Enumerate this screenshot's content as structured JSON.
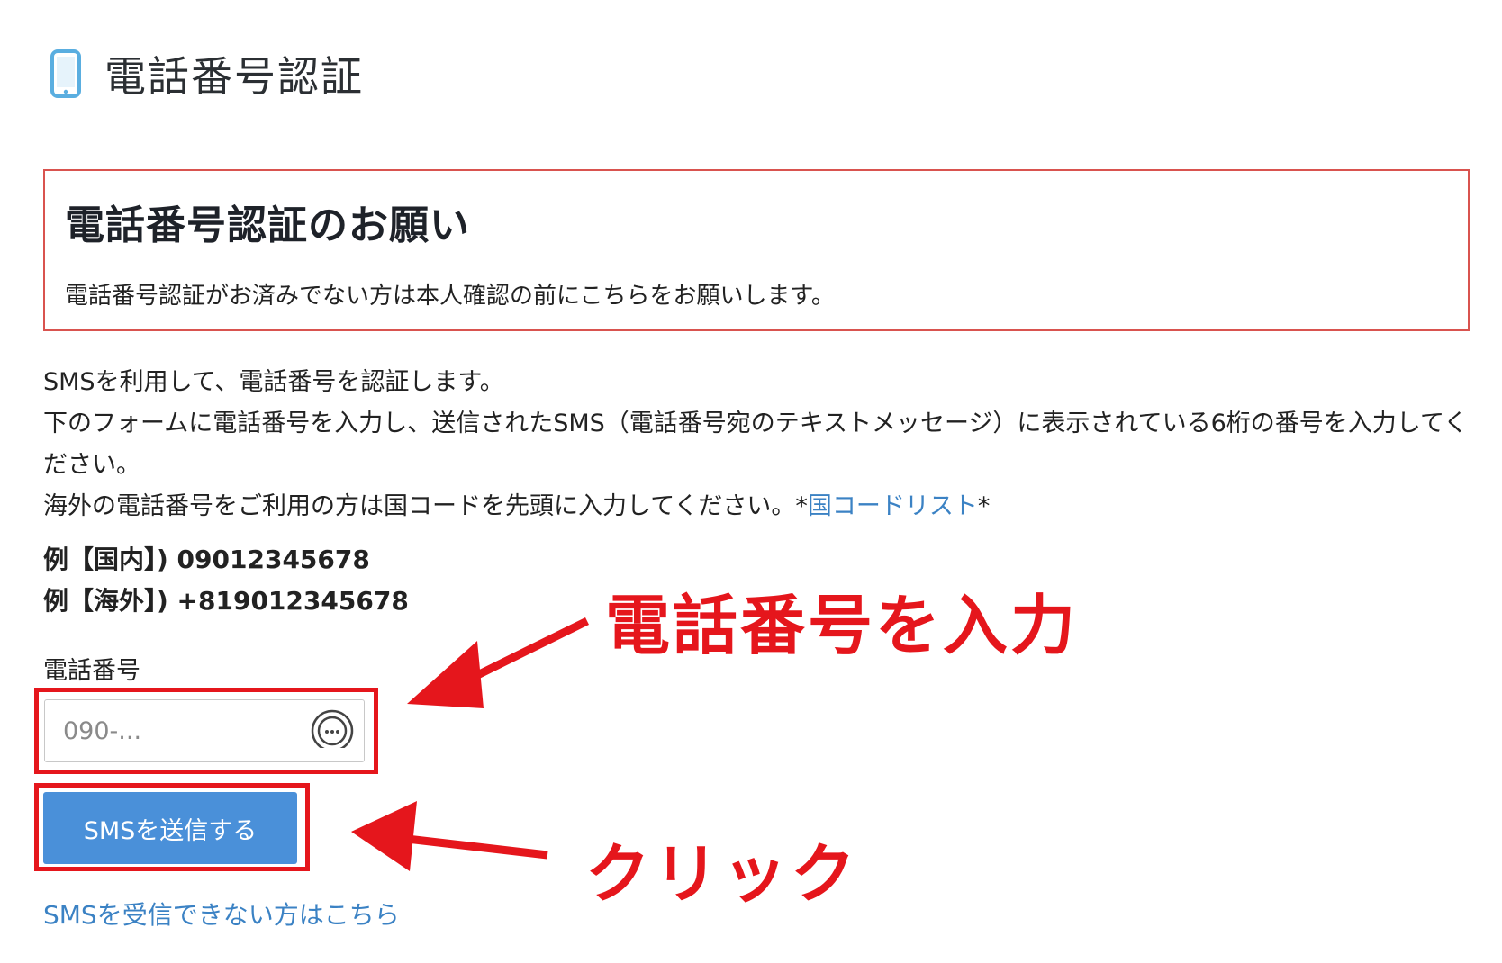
{
  "header": {
    "title": "電話番号認証",
    "icon": "phone-icon"
  },
  "notice": {
    "title": "電話番号認証のお願い",
    "body": "電話番号認証がお済みでない方は本人確認の前にこちらをお願いします。"
  },
  "description": {
    "line1": "SMSを利用して、電話番号を認証します。",
    "line2": "下のフォームに電話番号を入力し、送信されたSMS（電話番号宛のテキストメッセージ）に表示されている6桁の番号を入力してください。",
    "line3_prefix": "海外の電話番号をご利用の方は国コードを先頭に入力してください。*",
    "country_code_link": "国コードリスト",
    "line3_suffix": "*"
  },
  "examples": {
    "domestic": "例【国内】) 09012345678",
    "overseas": "例【海外】) +819012345678"
  },
  "form": {
    "phone_label": "電話番号",
    "phone_placeholder": "090-...",
    "phone_value": "",
    "submit_label": "SMSを送信する"
  },
  "bottom_link": "SMSを受信できない方はこちら",
  "annotations": {
    "enter_phone": "電話番号を入力",
    "click": "クリック"
  },
  "colors": {
    "annotation_red": "#e5161c",
    "button_blue": "#4a90d9",
    "link_blue": "#3b82c4",
    "notice_border": "#d9534f",
    "phone_icon_blue": "#5aaee0"
  }
}
